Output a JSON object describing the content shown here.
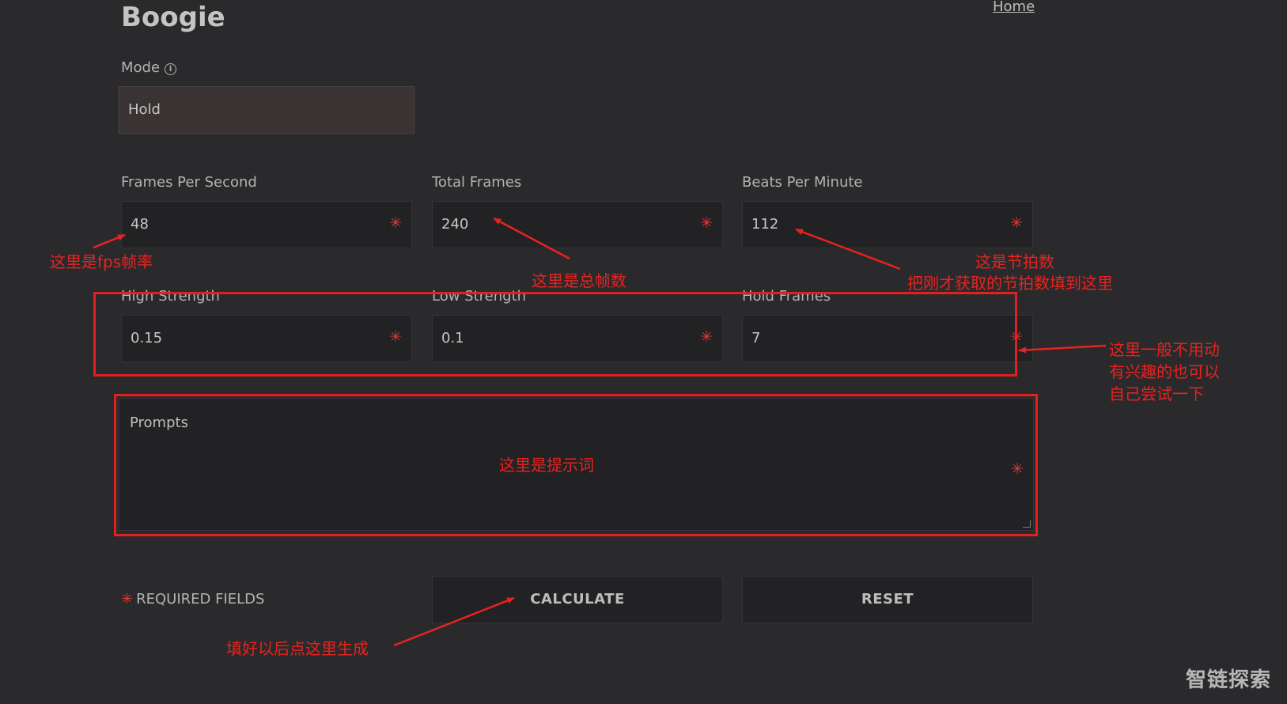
{
  "header": {
    "title": "Boogie",
    "home_link": "Home"
  },
  "mode": {
    "label": "Mode",
    "info_icon": "info-icon",
    "value": "Hold"
  },
  "fields": {
    "fps": {
      "label": "Frames Per Second",
      "value": "48"
    },
    "total_frames": {
      "label": "Total Frames",
      "value": "240"
    },
    "bpm": {
      "label": "Beats Per Minute",
      "value": "112"
    },
    "high_strength": {
      "label": "High Strength",
      "value": "0.15"
    },
    "low_strength": {
      "label": "Low Strength",
      "value": "0.1"
    },
    "hold_frames": {
      "label": "Hold Frames",
      "value": "7"
    },
    "prompts": {
      "placeholder": "Prompts"
    }
  },
  "required_marker": "✳",
  "required_note": "REQUIRED FIELDS",
  "buttons": {
    "calculate": "CALCULATE",
    "reset": "RESET"
  },
  "annotations": {
    "fps": "这里是fps帧率",
    "total_frames": "这里是总帧数",
    "bpm_line1": "这是节拍数",
    "bpm_line2": "把刚才获取的节拍数填到这里",
    "strength_line1": "这里一般不用动",
    "strength_line2": "有兴趣的也可以",
    "strength_line3": "自己尝试一下",
    "prompts": "这里是提示词",
    "calculate": "填好以后点这里生成"
  },
  "watermark": "智链探索",
  "colors": {
    "background": "#2a2a2c",
    "input": "#222224",
    "required": "#e03a3a",
    "annotation": "#e8231f"
  }
}
